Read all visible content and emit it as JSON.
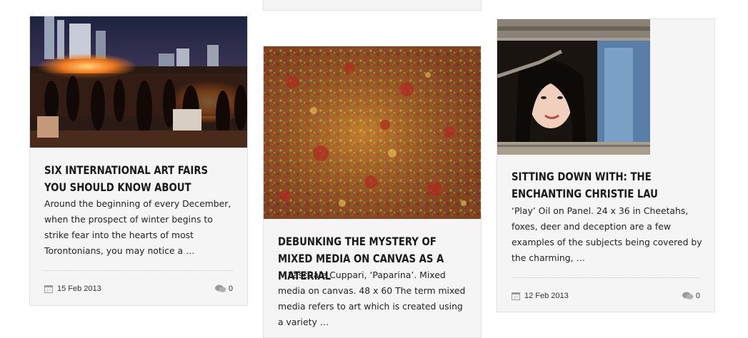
{
  "posts": [
    {
      "title": "Six International Art Fairs You Should Know About",
      "excerpt": "Around the beginning of every December, when the prospect of winter begins to strike fear into the hearts of most Torontonians, you may notice a …",
      "date": "15 Feb 2013",
      "comments": "0",
      "image": "art-fair-beach-bonfire-night"
    },
    {
      "title": "Debunking the Mystery of Mixed Media on Canvas as a Material",
      "excerpt": "Pascuale Cuppari, ‘Paparina’. Mixed media on canvas. 48 x 60   The term mixed media refers to art which is created using a variety …",
      "image": "mixed-media-abstract-painting"
    },
    {
      "title": "Sitting Down With: The Enchanting Christie Lau",
      "excerpt": "‘Play’ Oil on Panel. 24 x 36 in Cheetahs, foxes, deer and deception are a few examples of the subjects being covered by the charming, …",
      "date": "12 Feb 2013",
      "comments": "0",
      "image": "woman-in-wooden-window"
    }
  ],
  "icons": {
    "calendar": "calendar-icon",
    "comment": "comment-icon"
  },
  "colors": {
    "card_bg": "#f5f5f5",
    "card_border": "#e2e2e2",
    "text": "#1a1a1a",
    "meta_icon": "#9a9a9a"
  }
}
